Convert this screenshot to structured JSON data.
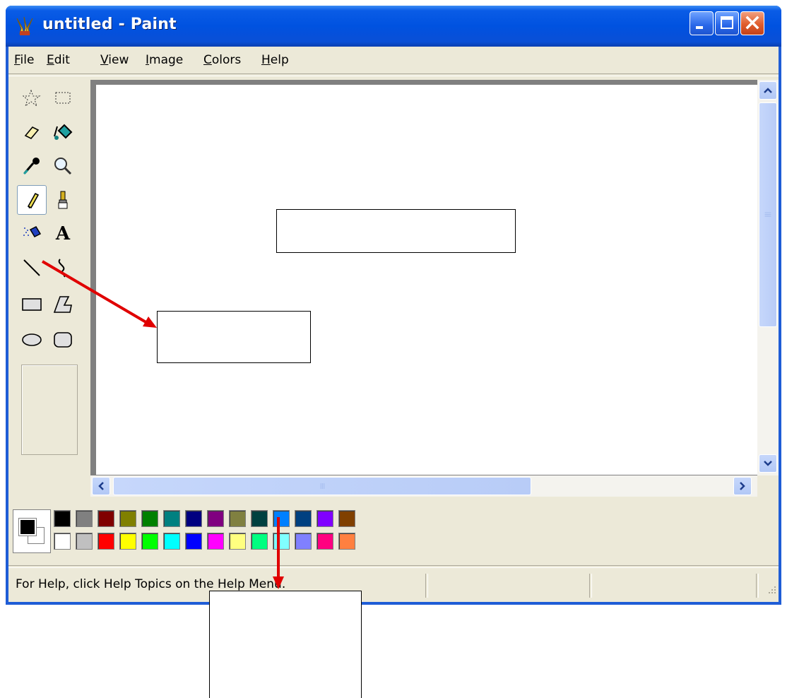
{
  "window": {
    "title": "untitled - Paint",
    "app_icon": "paint-icon",
    "controls": [
      "minimize-icon",
      "maximize-icon",
      "close-icon"
    ]
  },
  "menu": {
    "file": {
      "accel": "F",
      "rest": "ile"
    },
    "edit": {
      "accel": "E",
      "rest": "dit"
    },
    "view": {
      "accel": "V",
      "rest": "iew"
    },
    "image": {
      "accel": "I",
      "rest": "mage"
    },
    "colors": {
      "accel": "C",
      "rest": "olors"
    },
    "help": {
      "accel": "H",
      "rest": "elp"
    }
  },
  "toolbox": {
    "tools": [
      "free-form-select-icon",
      "select-icon",
      "eraser-icon",
      "fill-icon",
      "pick-color-icon",
      "magnifier-icon",
      "pencil-icon",
      "brush-icon",
      "airbrush-icon",
      "text-icon",
      "line-icon",
      "curve-icon",
      "rectangle-icon",
      "polygon-icon",
      "ellipse-icon",
      "rounded-rectangle-icon"
    ],
    "selected_tool": "pencil-icon",
    "text_tool_label": "A"
  },
  "scrollbars": {
    "horizontal_grip": "III",
    "vertical_grip": "≡"
  },
  "palette": {
    "foreground": "#000000",
    "background": "#ffffff",
    "row1": [
      "#000000",
      "#808080",
      "#800000",
      "#808000",
      "#008000",
      "#008080",
      "#000080",
      "#800080",
      "#808040",
      "#004040",
      "#0080ff",
      "#004080",
      "#8000ff",
      "#804000"
    ],
    "row2": [
      "#ffffff",
      "#c0c0c0",
      "#ff0000",
      "#ffff00",
      "#00ff00",
      "#00ffff",
      "#0000ff",
      "#ff00ff",
      "#ffff80",
      "#00ff80",
      "#80ffff",
      "#8080ff",
      "#ff0080",
      "#ff8040"
    ]
  },
  "status": {
    "help_text": "For Help, click Help Topics on the Help Menu."
  },
  "annotations": {
    "arrow_color": "#e00000"
  }
}
